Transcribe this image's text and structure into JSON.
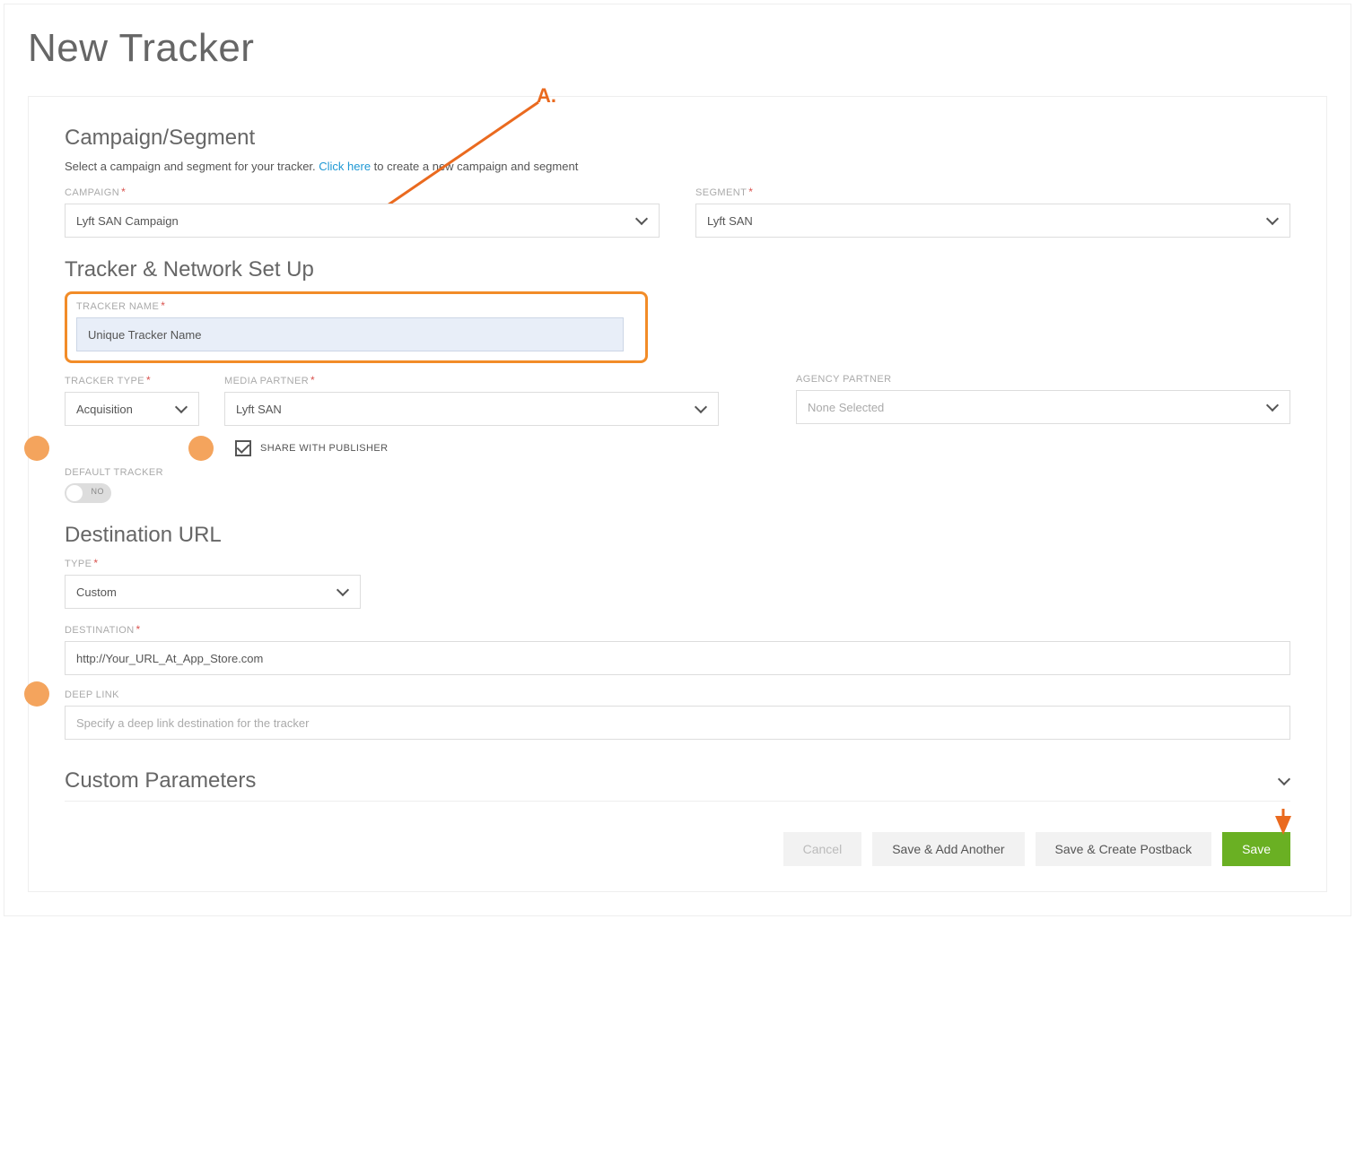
{
  "page": {
    "title": "New Tracker"
  },
  "annotations": {
    "a_label": "A."
  },
  "campaign_section": {
    "title": "Campaign/Segment",
    "helper_pre": "Select a campaign and segment for your tracker. ",
    "helper_link": "Click here",
    "helper_post": " to create a new campaign and segment",
    "campaign_label": "CAMPAIGN",
    "campaign_value": "Lyft SAN Campaign",
    "segment_label": "SEGMENT",
    "segment_value": "Lyft SAN"
  },
  "tracker_section": {
    "title": "Tracker & Network Set Up",
    "name_label": "TRACKER NAME",
    "name_value": "Unique Tracker Name",
    "type_label": "TRACKER TYPE",
    "type_value": "Acquisition",
    "media_label": "MEDIA PARTNER",
    "media_value": "Lyft SAN",
    "agency_label": "AGENCY PARTNER",
    "agency_value": "None Selected",
    "share_label": "SHARE WITH PUBLISHER",
    "share_checked": true,
    "default_label": "DEFAULT TRACKER",
    "default_toggle": "NO"
  },
  "destination_section": {
    "title": "Destination URL",
    "type_label": "TYPE",
    "type_value": "Custom",
    "dest_label": "DESTINATION",
    "dest_value": "http://Your_URL_At_App_Store.com",
    "deeplink_label": "DEEP LINK",
    "deeplink_placeholder": "Specify a deep link destination for the tracker"
  },
  "custom_params": {
    "title": "Custom Parameters"
  },
  "buttons": {
    "cancel": "Cancel",
    "save_add": "Save & Add Another",
    "save_postback": "Save & Create Postback",
    "save": "Save"
  }
}
